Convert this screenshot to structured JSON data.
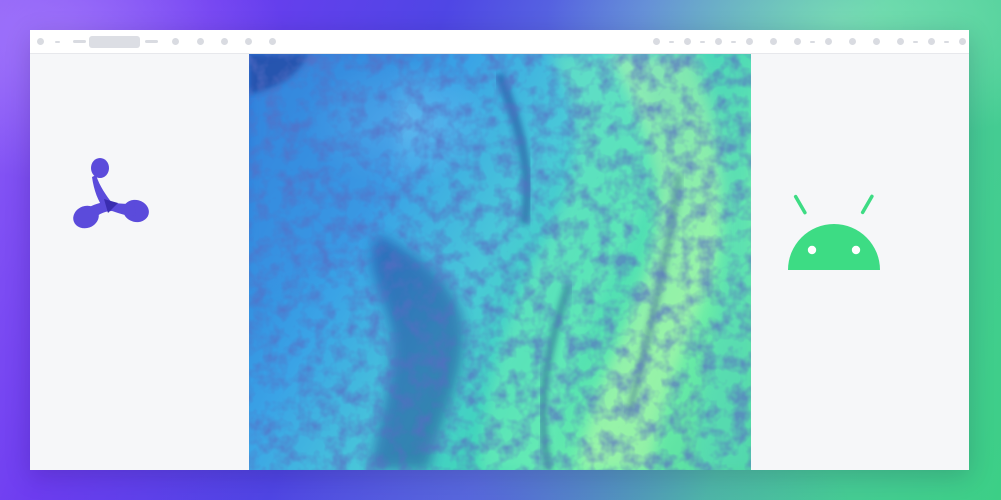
{
  "toolbar": {
    "left_icons": [
      "dot-icon",
      "tick-icon",
      "dash-icon",
      "placeholder-pill",
      "dash-icon",
      "dot-icon",
      "dot-icon",
      "dot-icon",
      "dot-icon",
      "dot-icon"
    ],
    "right_icons": [
      "dot-icon",
      "tick-icon",
      "dot-icon",
      "tick-icon",
      "dot-icon",
      "tick-icon",
      "dot-icon",
      "dot-icon",
      "dot-icon",
      "tick-icon",
      "dot-icon",
      "dot-icon",
      "dot-icon",
      "dot-icon",
      "tick-icon",
      "dot-icon",
      "tick-icon",
      "dot-icon"
    ]
  },
  "left_panel": {
    "logo": "pspdfkit-logo",
    "logo_color": "#5b4bdb"
  },
  "main": {
    "image": "aerial-river-abstract-image",
    "palette": [
      "#2a6fd6",
      "#3aa3e6",
      "#49c8d8",
      "#40d6b8",
      "#6ff0a8",
      "#1b2e8a"
    ]
  },
  "right_panel": {
    "logo": "android-logo",
    "logo_color": "#3ddc84"
  },
  "background": {
    "colors": [
      "#8b5cf6",
      "#4f46e5",
      "#3ccf86"
    ]
  }
}
